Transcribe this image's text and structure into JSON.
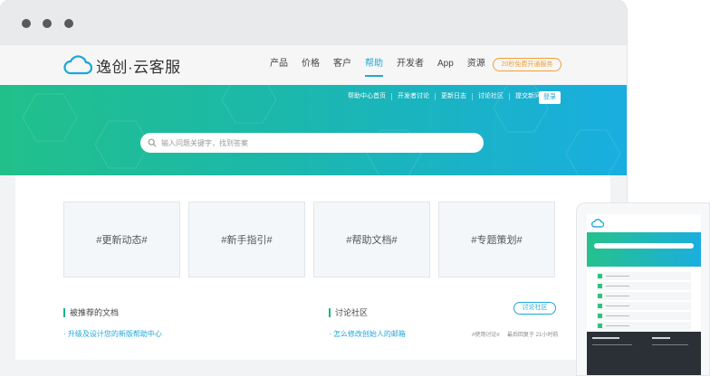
{
  "brand": {
    "name": "逸创·云客服"
  },
  "nav": [
    {
      "label": "产品",
      "active": false
    },
    {
      "label": "价格",
      "active": false
    },
    {
      "label": "客户",
      "active": false
    },
    {
      "label": "帮助",
      "active": true
    },
    {
      "label": "开发者",
      "active": false
    },
    {
      "label": "App",
      "active": false
    },
    {
      "label": "资源",
      "active": false
    }
  ],
  "trial_button": "20秒免费开通服务",
  "subnav": [
    "帮助中心首页",
    "开发者讨论",
    "更新日志",
    "讨论社区",
    "提交新问题"
  ],
  "login_button": "登录",
  "search": {
    "placeholder": "输入问题关键字，找到答案"
  },
  "cards": [
    "#更新动态#",
    "#新手指引#",
    "#帮助文档#",
    "#专题策划#"
  ],
  "recommended": {
    "title": "被推荐的文档",
    "items": [
      "升级及设计您的新版帮助中心"
    ]
  },
  "forum": {
    "title": "讨论社区",
    "button": "讨论社区",
    "items": [
      {
        "title": "怎么修改创始人的邮箱",
        "tag": "#使用讨论#",
        "time": "最后回复于 21小时前"
      }
    ]
  },
  "colors": {
    "accent": "#20a8d8",
    "green": "#21c08a",
    "trial": "#f0a030"
  }
}
